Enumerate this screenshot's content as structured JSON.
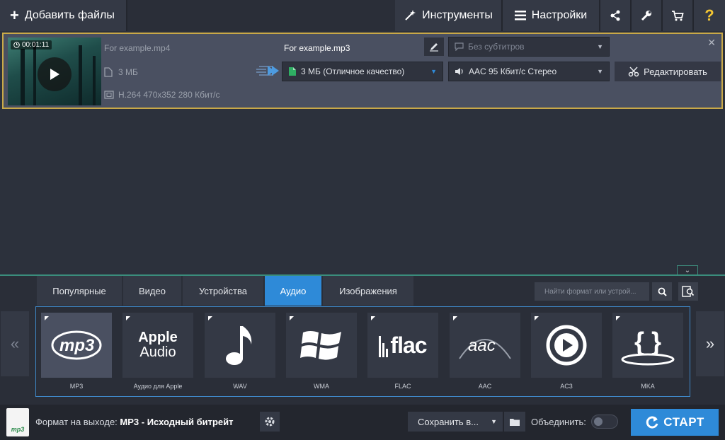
{
  "toolbar": {
    "add_files": "Добавить файлы",
    "tools": "Инструменты",
    "settings": "Настройки",
    "help": "?"
  },
  "file": {
    "duration": "00:01:11",
    "source_name": "For example.mp4",
    "source_size": "3 МБ",
    "source_codec": "H.264 470x352 280 Кбит/с",
    "output_name": "For example.mp3",
    "subtitles": "Без субтитров",
    "quality": "3 МБ (Отличное качество)",
    "audio": "AAC 95 Кбит/с Стерео",
    "edit_label": "Редактировать"
  },
  "tabs": [
    {
      "label": "Популярные"
    },
    {
      "label": "Видео"
    },
    {
      "label": "Устройства"
    },
    {
      "label": "Аудио",
      "active": true
    },
    {
      "label": "Изображения"
    }
  ],
  "search": {
    "placeholder": "Найти формат или устрой..."
  },
  "formats": [
    {
      "label": "MP3",
      "icon": "mp3-icon",
      "selected": true
    },
    {
      "label": "Аудио для Apple",
      "icon": "apple-audio-icon",
      "logo_line1": "Apple",
      "logo_line2": "Audio"
    },
    {
      "label": "WAV",
      "icon": "music-note-icon"
    },
    {
      "label": "WMA",
      "icon": "windows-icon"
    },
    {
      "label": "FLAC",
      "icon": "flac-icon",
      "logo": "flac"
    },
    {
      "label": "AAC",
      "icon": "aac-icon",
      "logo": "aac"
    },
    {
      "label": "AC3",
      "icon": "ac3-play-icon"
    },
    {
      "label": "MKA",
      "icon": "mka-braces-icon",
      "logo": "{ }"
    }
  ],
  "bottom": {
    "format_prefix": "Формат на выходе:",
    "format_value": "MP3 - Исходный битрейт",
    "file_badge": "mp3",
    "save_to": "Сохранить в...",
    "merge": "Объединить:",
    "merge_on": false,
    "start": "СТАРТ"
  },
  "colors": {
    "accent": "#2e8ad8",
    "selection_border": "#c9a948",
    "help": "#f2c533"
  }
}
